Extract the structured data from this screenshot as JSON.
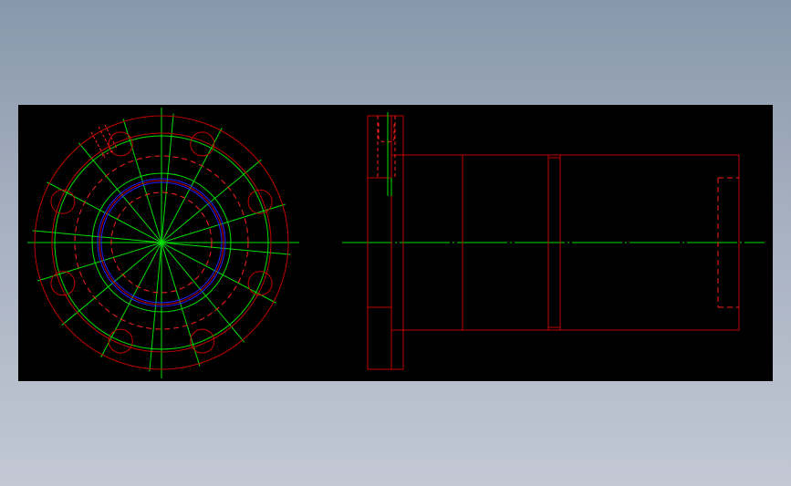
{
  "colors": {
    "background_top": "#8898ac",
    "background_bottom": "#c2c8d4",
    "canvas": "#000000",
    "part_line": "#c00000",
    "hidden_line": "#ff2020",
    "center_line": "#00e000",
    "thread_line": "#2020ff"
  },
  "drawing": {
    "views": [
      "front-view",
      "side-view"
    ],
    "front_view": {
      "bolt_hole_count": 8,
      "radial_centerline_count": 8
    },
    "side_view": {
      "sections": [
        "flange",
        "body",
        "groove",
        "body"
      ]
    }
  }
}
